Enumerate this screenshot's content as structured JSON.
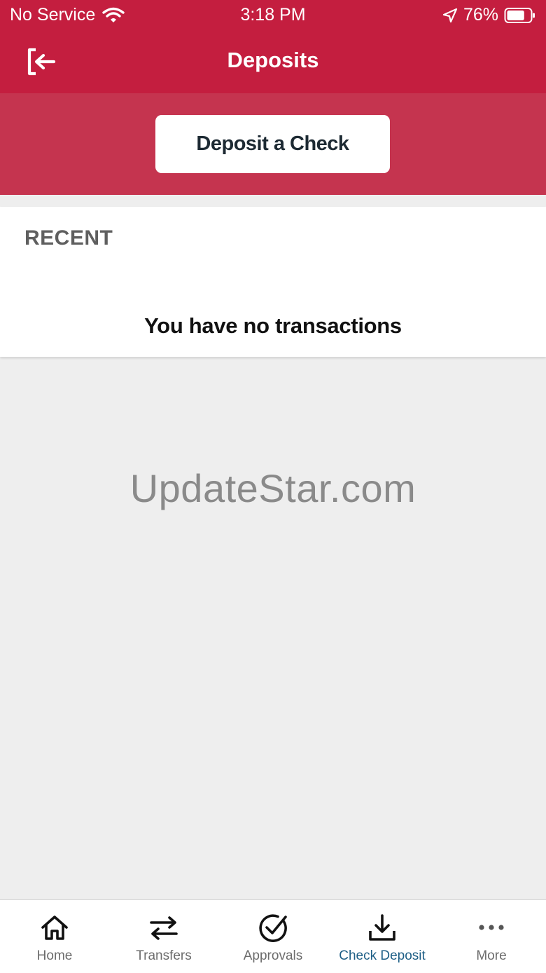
{
  "status_bar": {
    "carrier": "No Service",
    "time": "3:18 PM",
    "battery": "76%",
    "battery_level": 0.76
  },
  "header": {
    "title": "Deposits",
    "exit_icon": "exit-icon"
  },
  "actions": {
    "deposit_button": "Deposit a Check"
  },
  "recent": {
    "title": "RECENT",
    "empty_message": "You have no transactions"
  },
  "watermark": "UpdateStar.com",
  "tabs": [
    {
      "label": "Home",
      "icon": "home-icon",
      "active": false
    },
    {
      "label": "Transfers",
      "icon": "transfer-arrows-icon",
      "active": false
    },
    {
      "label": "Approvals",
      "icon": "check-circle-icon",
      "active": false
    },
    {
      "label": "Check Deposit",
      "icon": "download-tray-icon",
      "active": true
    },
    {
      "label": "More",
      "icon": "more-dots-icon",
      "active": false
    }
  ],
  "colors": {
    "header_red": "#c41e3f",
    "band_red": "#c5344f",
    "active_tab": "#1e5f86"
  }
}
